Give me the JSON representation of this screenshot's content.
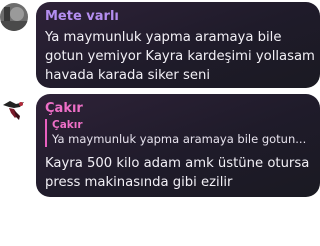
{
  "messages": [
    {
      "sender": "Mete varlı",
      "sender_color": "#b48ef0",
      "lines": [
        "Ya maymunluk yapma aramaya bile",
        "gotun yemiyor Kayra kardeşimi yollasam",
        "havada karada siker seni"
      ]
    },
    {
      "sender": "Çakır",
      "sender_color": "#ee6fc7",
      "reply": {
        "name": "Çakır",
        "text": "Ya maymunluk yapma aramaya bile gotun..."
      },
      "lines": [
        "Kayra 500 kilo adam amk üstüne otursa",
        "press makinasında gibi ezilir"
      ]
    }
  ]
}
